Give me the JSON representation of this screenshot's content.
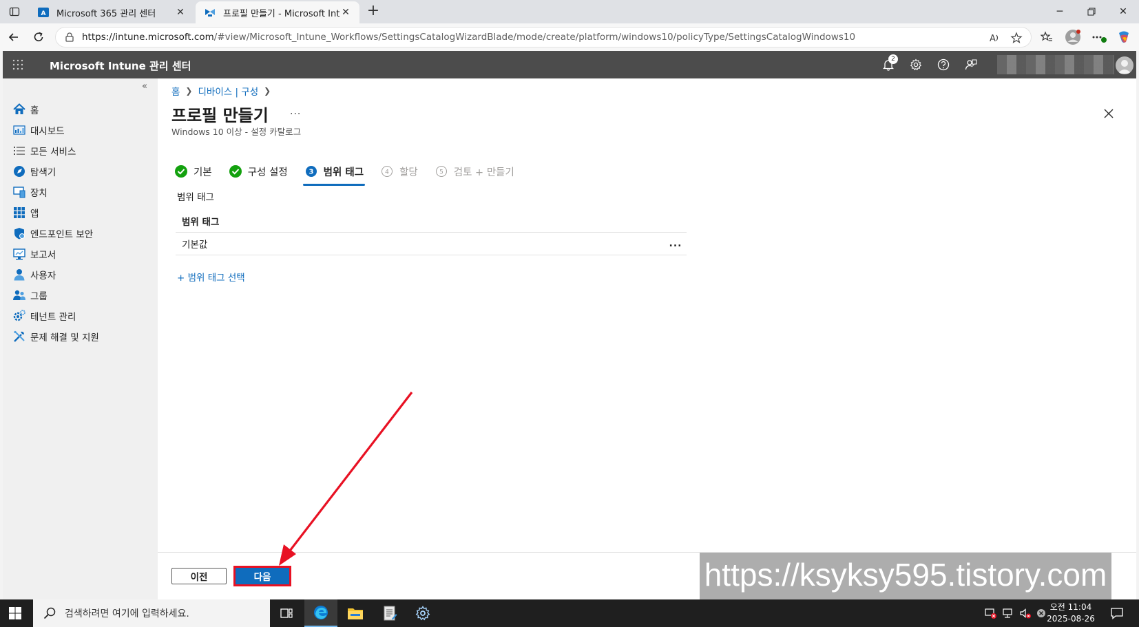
{
  "browser": {
    "tabs": [
      {
        "title": "Microsoft 365 관리 센터",
        "active": false
      },
      {
        "title": "프로필 만들기 - Microsoft Intune",
        "active": true
      }
    ],
    "url_host": "https://intune.microsoft.com",
    "url_path": "/#view/Microsoft_Intune_Workflows/SettingsCatalogWizardBlade/mode/create/platform/windows10/policyType/SettingsCatalogWindows10",
    "colors": {
      "accent": "#0f6cbd",
      "header": "#4c4c4c",
      "highlight": "#e81123"
    }
  },
  "header": {
    "title": "Microsoft Intune 관리 센터",
    "notification_count": "2",
    "icons": [
      "bell-icon",
      "gear-icon",
      "help-icon",
      "feedback-icon"
    ]
  },
  "sidebar": {
    "items": [
      {
        "label": "홈",
        "icon": "home-icon"
      },
      {
        "label": "대시보드",
        "icon": "dashboard-icon"
      },
      {
        "label": "모든 서비스",
        "icon": "list-icon"
      },
      {
        "label": "탐색기",
        "icon": "explorer-icon"
      },
      {
        "label": "장치",
        "icon": "device-icon"
      },
      {
        "label": "앱",
        "icon": "apps-icon"
      },
      {
        "label": "엔드포인트 보안",
        "icon": "shield-icon"
      },
      {
        "label": "보고서",
        "icon": "report-icon"
      },
      {
        "label": "사용자",
        "icon": "user-icon"
      },
      {
        "label": "그룹",
        "icon": "group-icon"
      },
      {
        "label": "테넌트 관리",
        "icon": "tenant-icon"
      },
      {
        "label": "문제 해결 및 지원",
        "icon": "tools-icon"
      }
    ]
  },
  "main": {
    "breadcrumb": [
      "홈",
      "디바이스 | 구성"
    ],
    "title": "프로필 만들기",
    "title_more": "...",
    "subtitle": "Windows 10 이상 - 설정 카탈로그",
    "steps": [
      {
        "number": "1",
        "label": "기본",
        "state": "done"
      },
      {
        "number": "2",
        "label": "구성 설정",
        "state": "done"
      },
      {
        "number": "3",
        "label": "범위 태그",
        "state": "current"
      },
      {
        "number": "4",
        "label": "할당",
        "state": "pending"
      },
      {
        "number": "5",
        "label": "검토 + 만들기",
        "state": "pending"
      }
    ],
    "section_label": "범위 태그",
    "table": {
      "header": "범위 태그",
      "rows": [
        "기본값"
      ],
      "row_more": "..."
    },
    "add_scope_link": "+ 범위 태그 선택",
    "footer": {
      "prev_label": "이전",
      "next_label": "다음"
    }
  },
  "watermark": "https://ksyksy595.tistory.com",
  "taskbar": {
    "search_placeholder": "검색하려면 여기에 입력하세요.",
    "time": "오전 11:04",
    "date": "2025-08-26"
  }
}
